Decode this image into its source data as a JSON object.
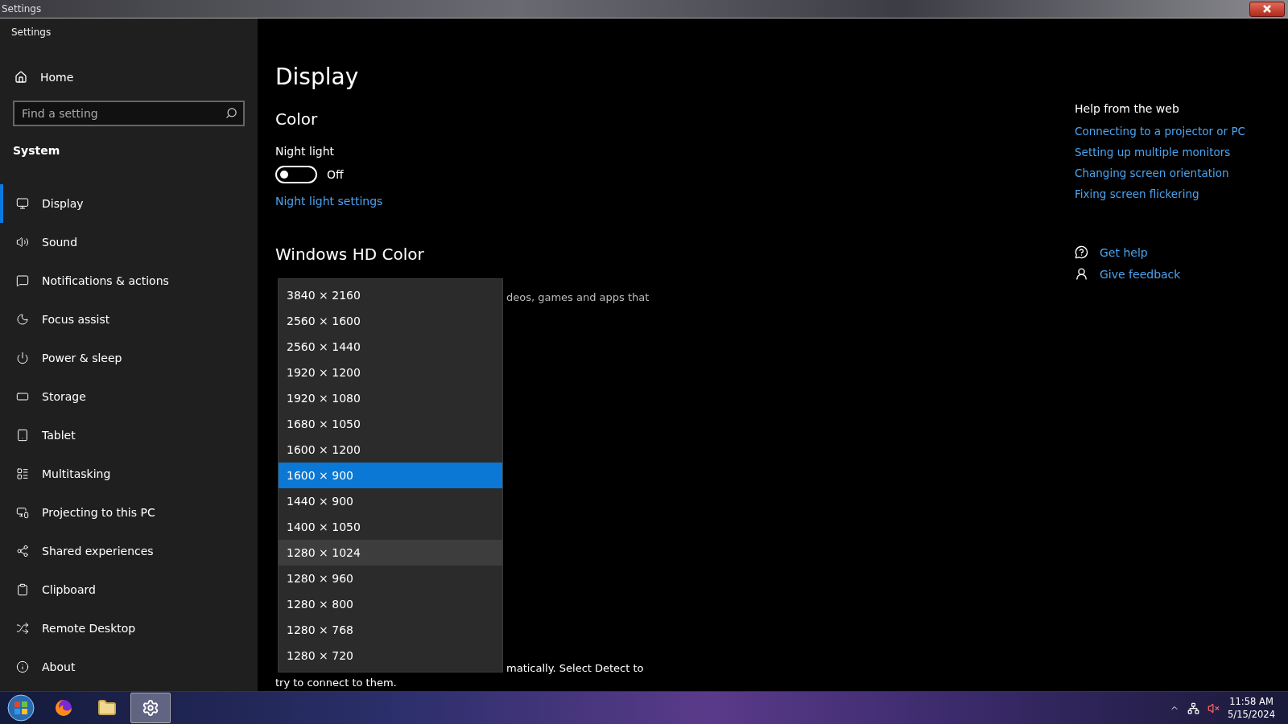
{
  "window": {
    "title": "Settings"
  },
  "sidebar": {
    "app_title": "Settings",
    "home": "Home",
    "search": {
      "placeholder": "Find a setting"
    },
    "section": "System",
    "items": [
      {
        "label": "Display",
        "selected": true
      },
      {
        "label": "Sound",
        "selected": false
      },
      {
        "label": "Notifications & actions",
        "selected": false
      },
      {
        "label": "Focus assist",
        "selected": false
      },
      {
        "label": "Power & sleep",
        "selected": false
      },
      {
        "label": "Storage",
        "selected": false
      },
      {
        "label": "Tablet",
        "selected": false
      },
      {
        "label": "Multitasking",
        "selected": false
      },
      {
        "label": "Projecting to this PC",
        "selected": false
      },
      {
        "label": "Shared experiences",
        "selected": false
      },
      {
        "label": "Clipboard",
        "selected": false
      },
      {
        "label": "Remote Desktop",
        "selected": false
      },
      {
        "label": "About",
        "selected": false
      }
    ]
  },
  "main": {
    "title": "Display",
    "color_heading": "Color",
    "night_light": {
      "label": "Night light",
      "on": false,
      "state_text": "Off"
    },
    "night_light_link": "Night light settings",
    "hd_heading": "Windows HD Color",
    "hd_text_fragment": "deos, games and apps that",
    "bottom_text_fragment": "matically. Select Detect to",
    "bottom_text_line2": "try to connect to them."
  },
  "resolution_dropdown": {
    "options": [
      {
        "label": "3840 × 2160",
        "selected": false,
        "hovered": false
      },
      {
        "label": "2560 × 1600",
        "selected": false,
        "hovered": false
      },
      {
        "label": "2560 × 1440",
        "selected": false,
        "hovered": false
      },
      {
        "label": "1920 × 1200",
        "selected": false,
        "hovered": false
      },
      {
        "label": "1920 × 1080",
        "selected": false,
        "hovered": false
      },
      {
        "label": "1680 × 1050",
        "selected": false,
        "hovered": false
      },
      {
        "label": "1600 × 1200",
        "selected": false,
        "hovered": false
      },
      {
        "label": "1600 × 900",
        "selected": true,
        "hovered": false
      },
      {
        "label": "1440 × 900",
        "selected": false,
        "hovered": false
      },
      {
        "label": "1400 × 1050",
        "selected": false,
        "hovered": false
      },
      {
        "label": "1280 × 1024",
        "selected": false,
        "hovered": true
      },
      {
        "label": "1280 × 960",
        "selected": false,
        "hovered": false
      },
      {
        "label": "1280 × 800",
        "selected": false,
        "hovered": false
      },
      {
        "label": "1280 × 768",
        "selected": false,
        "hovered": false
      },
      {
        "label": "1280 × 720",
        "selected": false,
        "hovered": false
      }
    ]
  },
  "help": {
    "heading": "Help from the web",
    "links": [
      "Connecting to a projector or PC",
      "Setting up multiple monitors",
      "Changing screen orientation",
      "Fixing screen flickering"
    ],
    "actions": [
      {
        "label": "Get help",
        "kind": "help"
      },
      {
        "label": "Give feedback",
        "kind": "feedback"
      }
    ]
  },
  "taskbar": {
    "apps": [
      {
        "kind": "browser",
        "active": false
      },
      {
        "kind": "folder",
        "active": false
      },
      {
        "kind": "settings",
        "active": true
      }
    ],
    "time": "11:58 AM",
    "date": "5/15/2024"
  }
}
